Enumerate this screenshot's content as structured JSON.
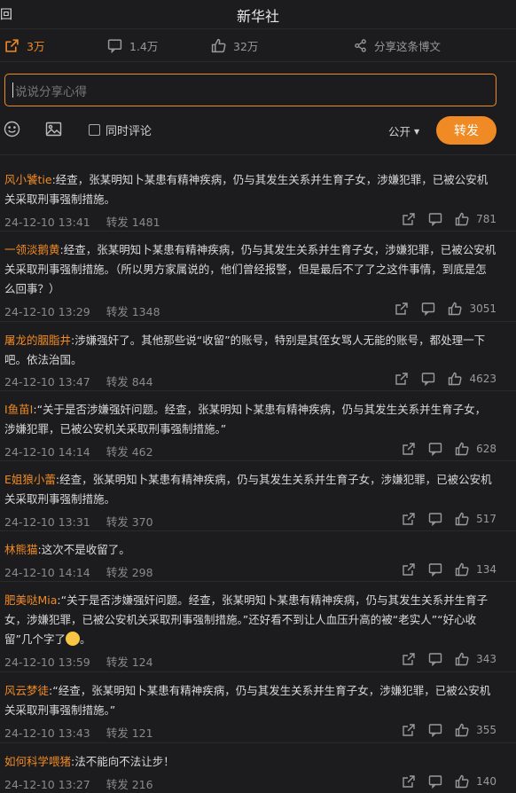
{
  "header": {
    "back_glyph": "回",
    "title": "新华社"
  },
  "stats": {
    "repost": "3万",
    "comment": "1.4万",
    "like": "32万",
    "share": "分享这条博文"
  },
  "composer": {
    "placeholder": "说说分享心得",
    "checkbox_label": "同时评论",
    "visibility": "公开",
    "repost_button": "转发"
  },
  "accent": "#f08a24",
  "comments": [
    {
      "user": "风小饕tie",
      "text": ":经查，张某明知卜某患有精神疾病，仍与其发生关系并生育子女，涉嫌犯罪，已被公安机关采取刑事强制措施。",
      "time": "24-12-10 13:41",
      "repost": "转发 1481",
      "likes": "781"
    },
    {
      "user": "一领淡鹅黄",
      "text": ":经查，张某明知卜某患有精神疾病，仍与其发生关系并生育子女，涉嫌犯罪，已被公安机关采取刑事强制措施。（所以男方家属说的，他们曾经报警，但是最后不了了之这件事情，到底是怎么回事？）",
      "time": "24-12-10 13:29",
      "repost": "转发 1348",
      "likes": "3051"
    },
    {
      "user": "屠龙的胭脂井",
      "text": ":涉嫌强奸了。其他那些说“收留”的账号，特别是其侄女骂人无能的账号，都处理一下吧。依法治国。",
      "time": "24-12-10 13:47",
      "repost": "转发 844",
      "likes": "4623"
    },
    {
      "user": "I鱼苗I",
      "text": ":“关于是否涉嫌强奸问题。经查，张某明知卜某患有精神疾病，仍与其发生关系并生育子女，涉嫌犯罪，已被公安机关采取刑事强制措施。”",
      "time": "24-12-10 14:14",
      "repost": "转发 462",
      "likes": "628"
    },
    {
      "user": "E姐狼小蕾",
      "text": ":经查，张某明知卜某患有精神疾病，仍与其发生关系并生育子女，涉嫌犯罪，已被公安机关采取刑事强制措施。",
      "time": "24-12-10 13:31",
      "repost": "转发 370",
      "likes": "517"
    },
    {
      "user": "林熊猫",
      "text": ":这次不是收留了。",
      "time": "24-12-10 14:14",
      "repost": "转发 298",
      "likes": "134"
    },
    {
      "user": "肥美哒Mia",
      "text": ":“关于是否涉嫌强奸问题。经查，张某明知卜某患有精神疾病，仍与其发生关系并生育子女，涉嫌犯罪，已被公安机关采取刑事强制措施。”还好看不到让人血压升高的被“老实人”“好心收留”几个字了",
      "emoji": "smile-emoji",
      "time": "24-12-10 13:59",
      "repost": "转发 124",
      "likes": "343"
    },
    {
      "user": "风云梦徒",
      "text": ":“经查，张某明知卜某患有精神疾病，仍与其发生关系并生育子女，涉嫌犯罪，已被公安机关采取刑事强制措施。”",
      "time": "24-12-10 13:43",
      "repost": "转发 121",
      "likes": "355"
    },
    {
      "user": "如何科学喂猪",
      "text": ":法不能向不法让步！",
      "time": "24-12-10 13:27",
      "repost": "转发 216",
      "likes": "140"
    }
  ]
}
